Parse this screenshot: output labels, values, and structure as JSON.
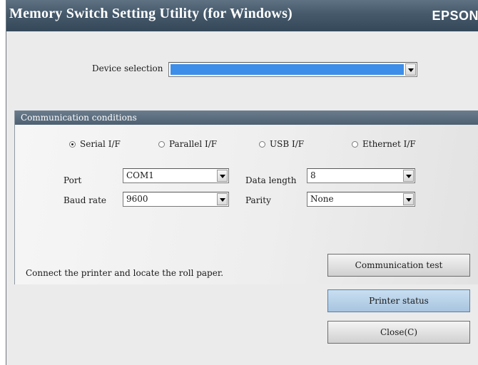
{
  "window": {
    "title": "Memory Switch Setting Utility (for Windows)",
    "brand": "EPSON"
  },
  "device": {
    "label": "Device selection",
    "value": ""
  },
  "comm": {
    "header": "Communication conditions",
    "interfaces": [
      {
        "label": "Serial I/F",
        "selected": true
      },
      {
        "label": "Parallel I/F",
        "selected": false
      },
      {
        "label": "USB I/F",
        "selected": false
      },
      {
        "label": "Ethernet I/F",
        "selected": false
      }
    ],
    "port": {
      "label": "Port",
      "value": "COM1"
    },
    "baud_rate": {
      "label": "Baud rate",
      "value": "9600"
    },
    "data_length": {
      "label": "Data length",
      "value": "8"
    },
    "parity": {
      "label": "Parity",
      "value": "None"
    }
  },
  "status_message": "Connect the printer and locate the roll paper.",
  "buttons": {
    "communication_test": "Communication test",
    "printer_status": "Printer status",
    "close": "Close(C)"
  },
  "colors": {
    "titlebar": "#45596b",
    "selection": "#3d8ee8",
    "accent_button": "#a7c4df"
  }
}
